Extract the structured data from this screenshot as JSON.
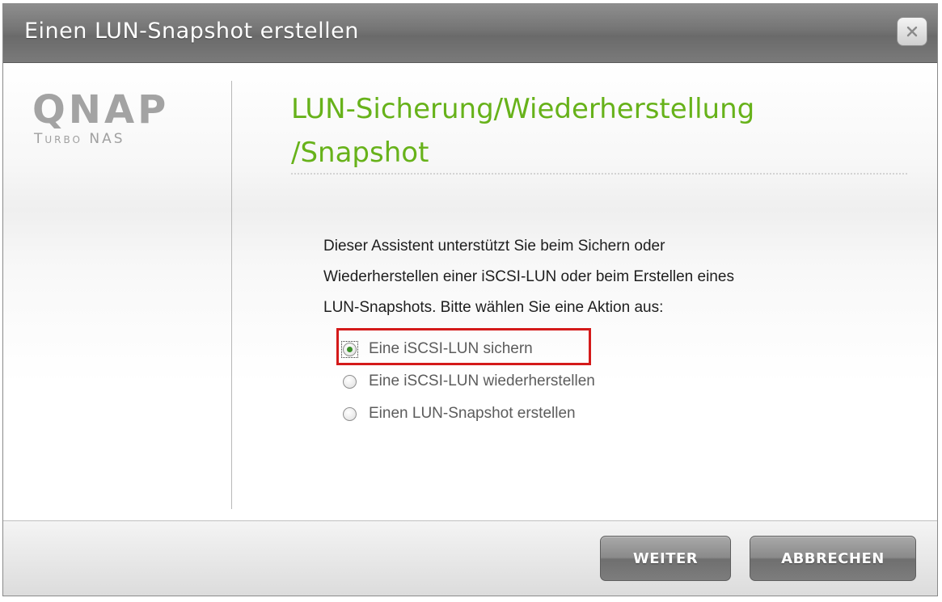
{
  "window": {
    "title": "Einen LUN-Snapshot erstellen",
    "close_icon": "close-icon"
  },
  "logo": {
    "brand": "QNAP",
    "product": "Turbo NAS"
  },
  "wizard": {
    "heading_line1": "LUN-Sicherung/Wiederherstellung",
    "heading_line2": "/Snapshot",
    "description": [
      "Dieser Assistent unterstützt Sie beim Sichern oder",
      "Wiederherstellen einer iSCSI-LUN oder beim Erstellen eines",
      "LUN-Snapshots. Bitte wählen Sie eine Aktion aus:"
    ],
    "options": [
      {
        "label": "Eine iSCSI-LUN sichern",
        "selected": true
      },
      {
        "label": "Eine iSCSI-LUN wiederherstellen",
        "selected": false
      },
      {
        "label": "Einen LUN-Snapshot erstellen",
        "selected": false
      }
    ]
  },
  "buttons": {
    "next": "WEITER",
    "cancel": "ABBRECHEN"
  },
  "colors": {
    "heading_green": "#67b21a",
    "highlight_red": "#d41a1a",
    "titlebar_gray": "#747474"
  }
}
